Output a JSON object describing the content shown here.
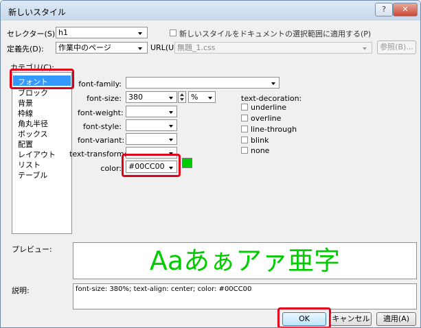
{
  "window": {
    "title": "新しいスタイル",
    "help_label": "?",
    "close_label": "✕"
  },
  "top": {
    "selector_label": "セレクター(S):",
    "selector_value": "h1",
    "apply_selection_label": "新しいスタイルをドキュメントの選択範囲に適用する(P)",
    "define_in_label": "定義先(D):",
    "define_in_value": "作業中のページ",
    "url_label": "URL(U):",
    "url_value": "無題_1.css",
    "browse_label": "参照(B)..."
  },
  "category": {
    "label": "カテゴリ(C):",
    "items": [
      "フォント",
      "ブロック",
      "背景",
      "枠線",
      "角丸半径",
      "ボックス",
      "配置",
      "レイアウト",
      "リスト",
      "テーブル"
    ],
    "selected": "フォント"
  },
  "font": {
    "family_label": "font-family:",
    "family_value": "",
    "size_label": "font-size:",
    "size_value": "380",
    "size_unit": "%",
    "weight_label": "font-weight:",
    "style_label": "font-style:",
    "variant_label": "font-variant:",
    "transform_label": "text-transform:",
    "color_label": "color:",
    "color_value": "#00CC00",
    "swatch_color": "#00CC00"
  },
  "decoration": {
    "label": "text-decoration:",
    "options": [
      "underline",
      "overline",
      "line-through",
      "blink",
      "none"
    ]
  },
  "preview": {
    "label": "プレビュー:",
    "text": "Aaあぁアァ亜字",
    "color": "#00CC00"
  },
  "description": {
    "label": "説明:",
    "text": "font-size: 380%; text-align: center; color: #00CC00"
  },
  "buttons": {
    "ok": "OK",
    "cancel": "キャンセル",
    "apply": "適用(A)"
  },
  "highlight_color": "#e0001c"
}
